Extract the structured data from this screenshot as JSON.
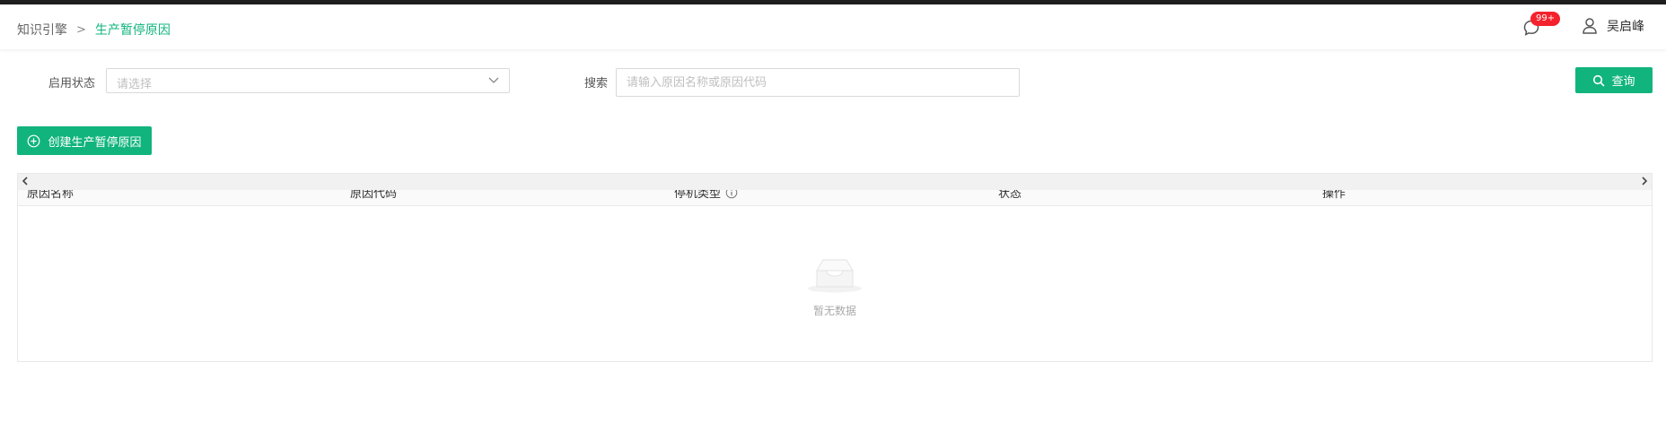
{
  "breadcrumb": {
    "root": "知识引擎",
    "separator": ">",
    "current": "生产暂停原因"
  },
  "header": {
    "badge": "99+",
    "user_name": "吴启峰",
    "icons": [
      "message-icon",
      "user-icon"
    ]
  },
  "filters": {
    "status_label": "启用状态",
    "status_placeholder": "请选择",
    "search_label": "搜索",
    "search_placeholder": "请输入原因名称或原因代码",
    "search_value": ""
  },
  "actions": {
    "query_label": "查询",
    "create_label": "创建生产暂停原因"
  },
  "table": {
    "columns": [
      "原因名称",
      "原因代码",
      "停机类型",
      "状态",
      "操作"
    ],
    "rows": [],
    "empty_text": "暂无数据"
  },
  "colors": {
    "accent": "#11b47d",
    "badge": "#f5222d"
  }
}
